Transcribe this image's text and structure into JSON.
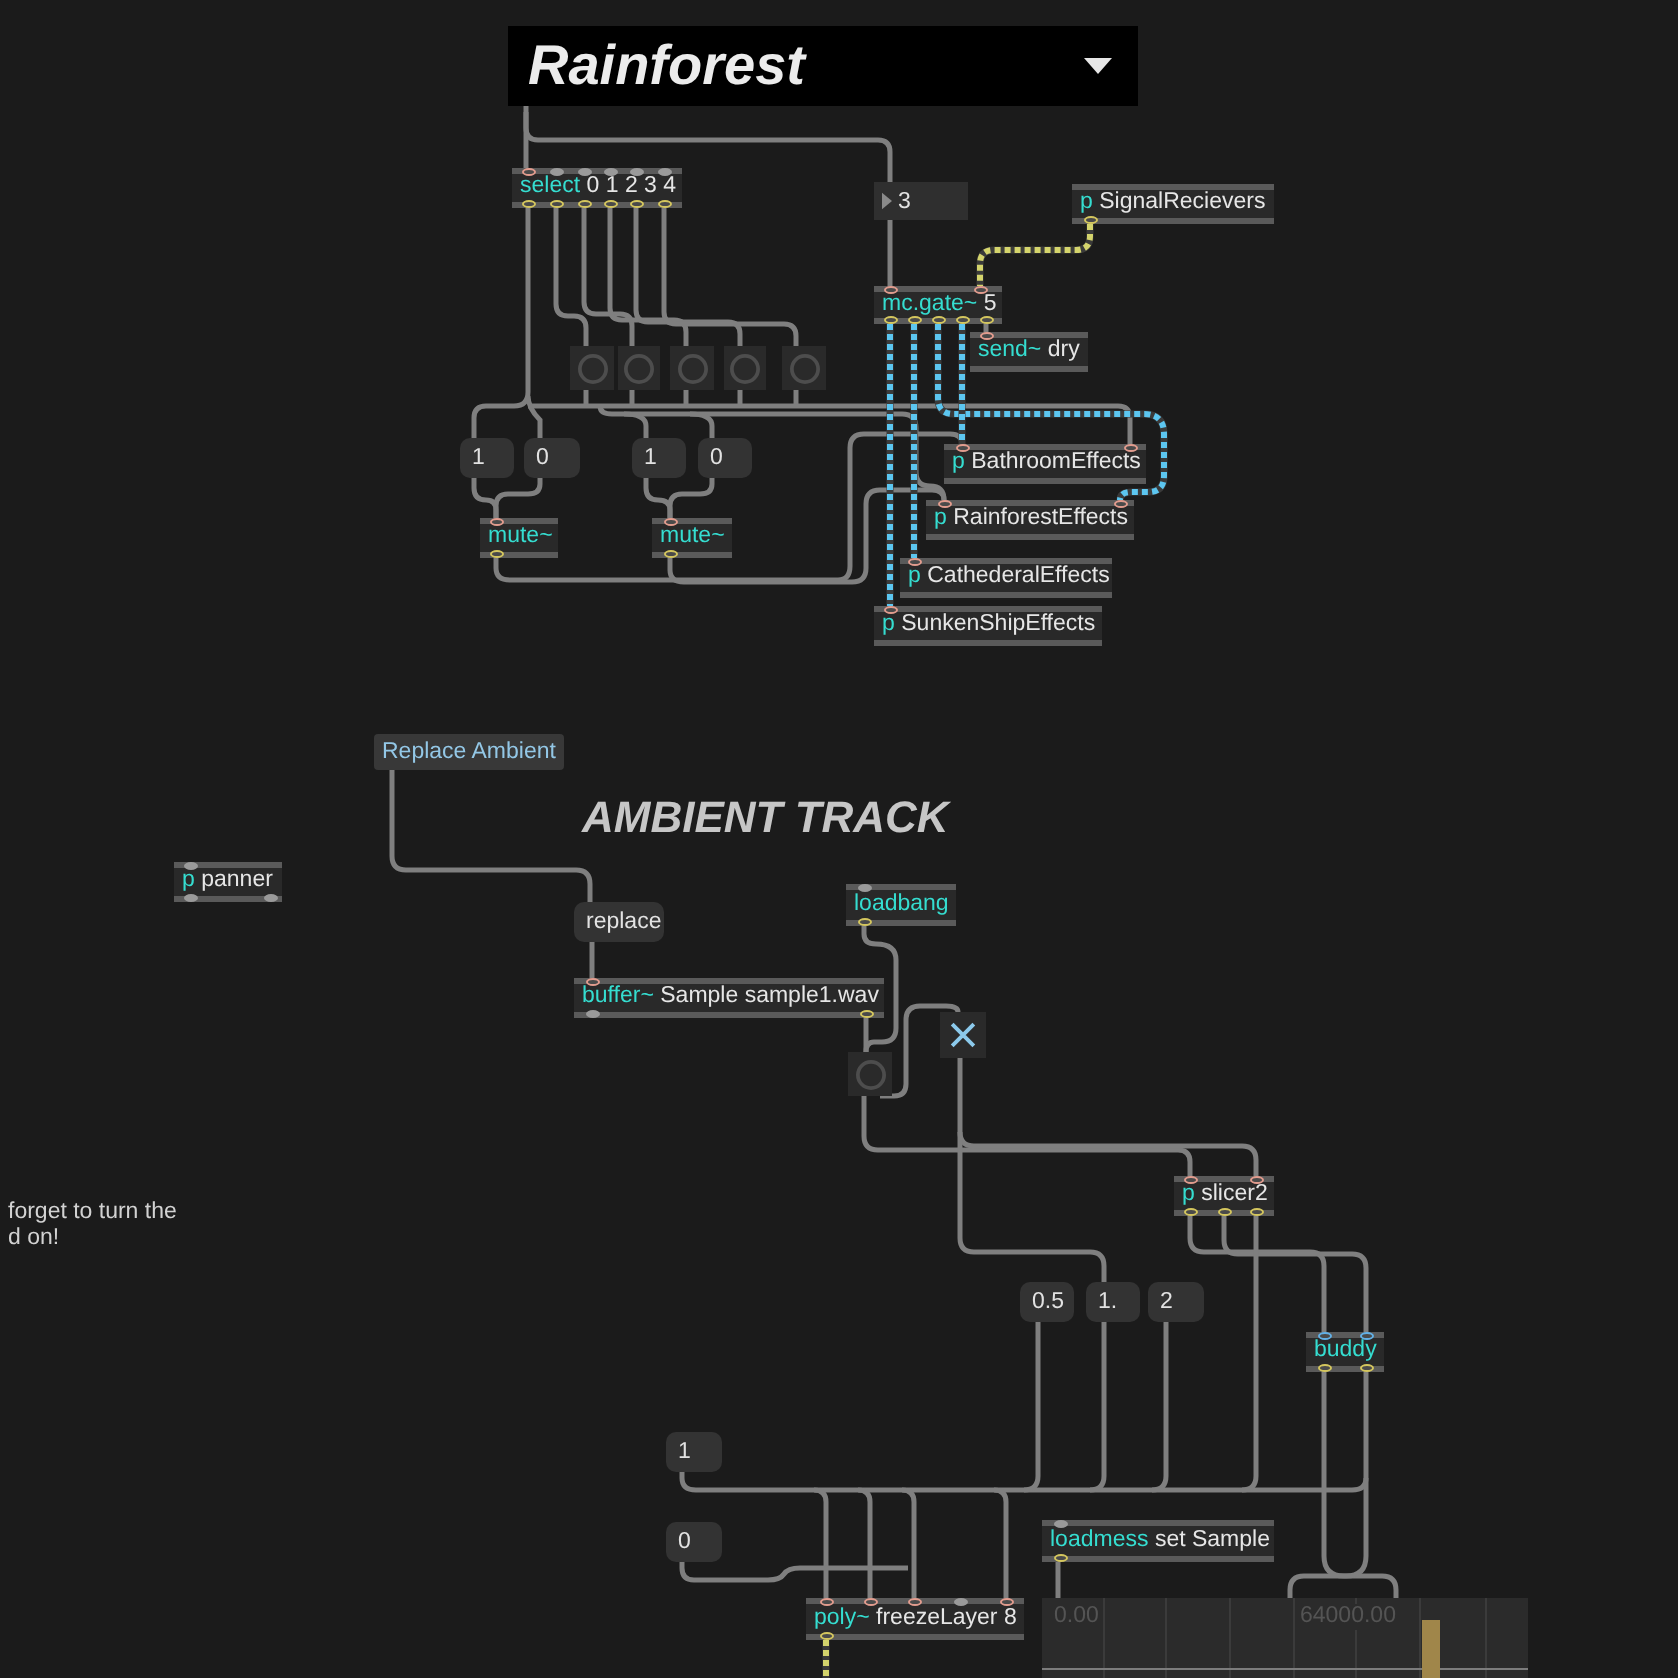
{
  "patcher": {
    "objects": [
      {
        "kind": "umenu",
        "text": "Rainforest"
      },
      {
        "kind": "object",
        "name": "select",
        "args": "0 1 2 3 4"
      },
      {
        "kind": "number",
        "text": "3"
      },
      {
        "kind": "object",
        "name": "p",
        "args": "SignalRecievers"
      },
      {
        "kind": "object",
        "name": "mc.gate~",
        "args": "5"
      },
      {
        "kind": "object",
        "name": "send~",
        "args": "dry"
      },
      {
        "kind": "bang"
      },
      {
        "kind": "bang"
      },
      {
        "kind": "bang"
      },
      {
        "kind": "bang"
      },
      {
        "kind": "bang"
      },
      {
        "kind": "message",
        "text": "1"
      },
      {
        "kind": "message",
        "text": "0"
      },
      {
        "kind": "message",
        "text": "1"
      },
      {
        "kind": "message",
        "text": "0"
      },
      {
        "kind": "object",
        "name": "p",
        "args": "BathroomEffects"
      },
      {
        "kind": "object",
        "name": "mute~"
      },
      {
        "kind": "object",
        "name": "mute~"
      },
      {
        "kind": "object",
        "name": "p",
        "args": "RainforestEffects"
      },
      {
        "kind": "object",
        "name": "p",
        "args": "CathederalEffects"
      },
      {
        "kind": "object",
        "name": "p",
        "args": "SunkenShipEffects"
      },
      {
        "kind": "textbutton",
        "text": "Replace Ambient"
      },
      {
        "kind": "heading",
        "text": "AMBIENT TRACK"
      },
      {
        "kind": "object",
        "name": "p",
        "args": "panner"
      },
      {
        "kind": "message",
        "text": "replace"
      },
      {
        "kind": "object",
        "name": "loadbang"
      },
      {
        "kind": "object",
        "name": "buffer~",
        "args": "Sample sample1.wav"
      },
      {
        "kind": "toggle",
        "checked": true
      },
      {
        "kind": "bang"
      },
      {
        "kind": "object",
        "name": "p",
        "args": "slicer2"
      },
      {
        "kind": "comment",
        "lines": [
          "forget to turn the",
          "d on!"
        ]
      },
      {
        "kind": "message",
        "text": "0.5"
      },
      {
        "kind": "message",
        "text": "1."
      },
      {
        "kind": "message",
        "text": "2"
      },
      {
        "kind": "object",
        "name": "buddy"
      },
      {
        "kind": "message",
        "text": "1"
      },
      {
        "kind": "message",
        "text": "0"
      },
      {
        "kind": "object",
        "name": "loadmess",
        "args": "set Sample"
      },
      {
        "kind": "object",
        "name": "poly~",
        "args": "freezeLayer 8"
      },
      {
        "kind": "waveform",
        "labels": [
          "0.00",
          "64000.00"
        ]
      }
    ]
  }
}
